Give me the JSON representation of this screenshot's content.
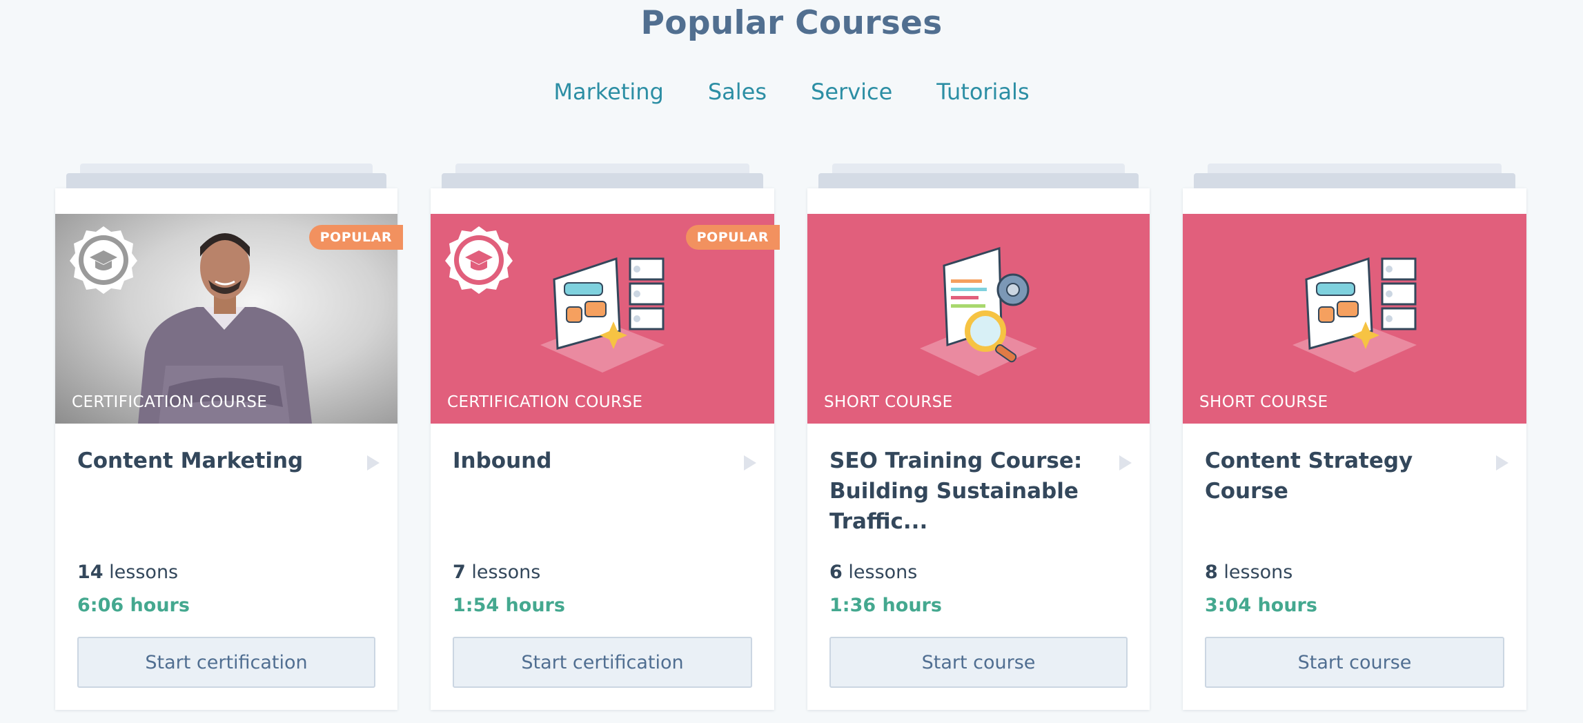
{
  "page": {
    "title": "Popular Courses"
  },
  "tabs": [
    {
      "label": "Marketing"
    },
    {
      "label": "Sales"
    },
    {
      "label": "Service"
    },
    {
      "label": "Tutorials"
    }
  ],
  "colors": {
    "accent_pink": "#e15f7c",
    "popular_badge": "#f2915f",
    "hours_green": "#44a88f",
    "tab_teal": "#2c8ea4"
  },
  "cards": [
    {
      "thumb_style": "photo",
      "badge": "POPULAR",
      "course_type": "CERTIFICATION COURSE",
      "title": "Content Marketing",
      "lessons_count": "14",
      "lessons_label": "lessons",
      "hours": "6:06 hours",
      "button": "Start certification"
    },
    {
      "thumb_style": "illustration-interface",
      "badge": "POPULAR",
      "course_type": "CERTIFICATION COURSE",
      "title": "Inbound",
      "lessons_count": "7",
      "lessons_label": "lessons",
      "hours": "1:54 hours",
      "button": "Start certification"
    },
    {
      "thumb_style": "illustration-seo",
      "badge": "",
      "course_type": "SHORT COURSE",
      "title": "SEO Training Course: Building Sustainable Traffic...",
      "lessons_count": "6",
      "lessons_label": "lessons",
      "hours": "1:36 hours",
      "button": "Start course"
    },
    {
      "thumb_style": "illustration-interface",
      "badge": "",
      "course_type": "SHORT COURSE",
      "title": "Content Strategy Course",
      "lessons_count": "8",
      "lessons_label": "lessons",
      "hours": "3:04 hours",
      "button": "Start course"
    }
  ]
}
